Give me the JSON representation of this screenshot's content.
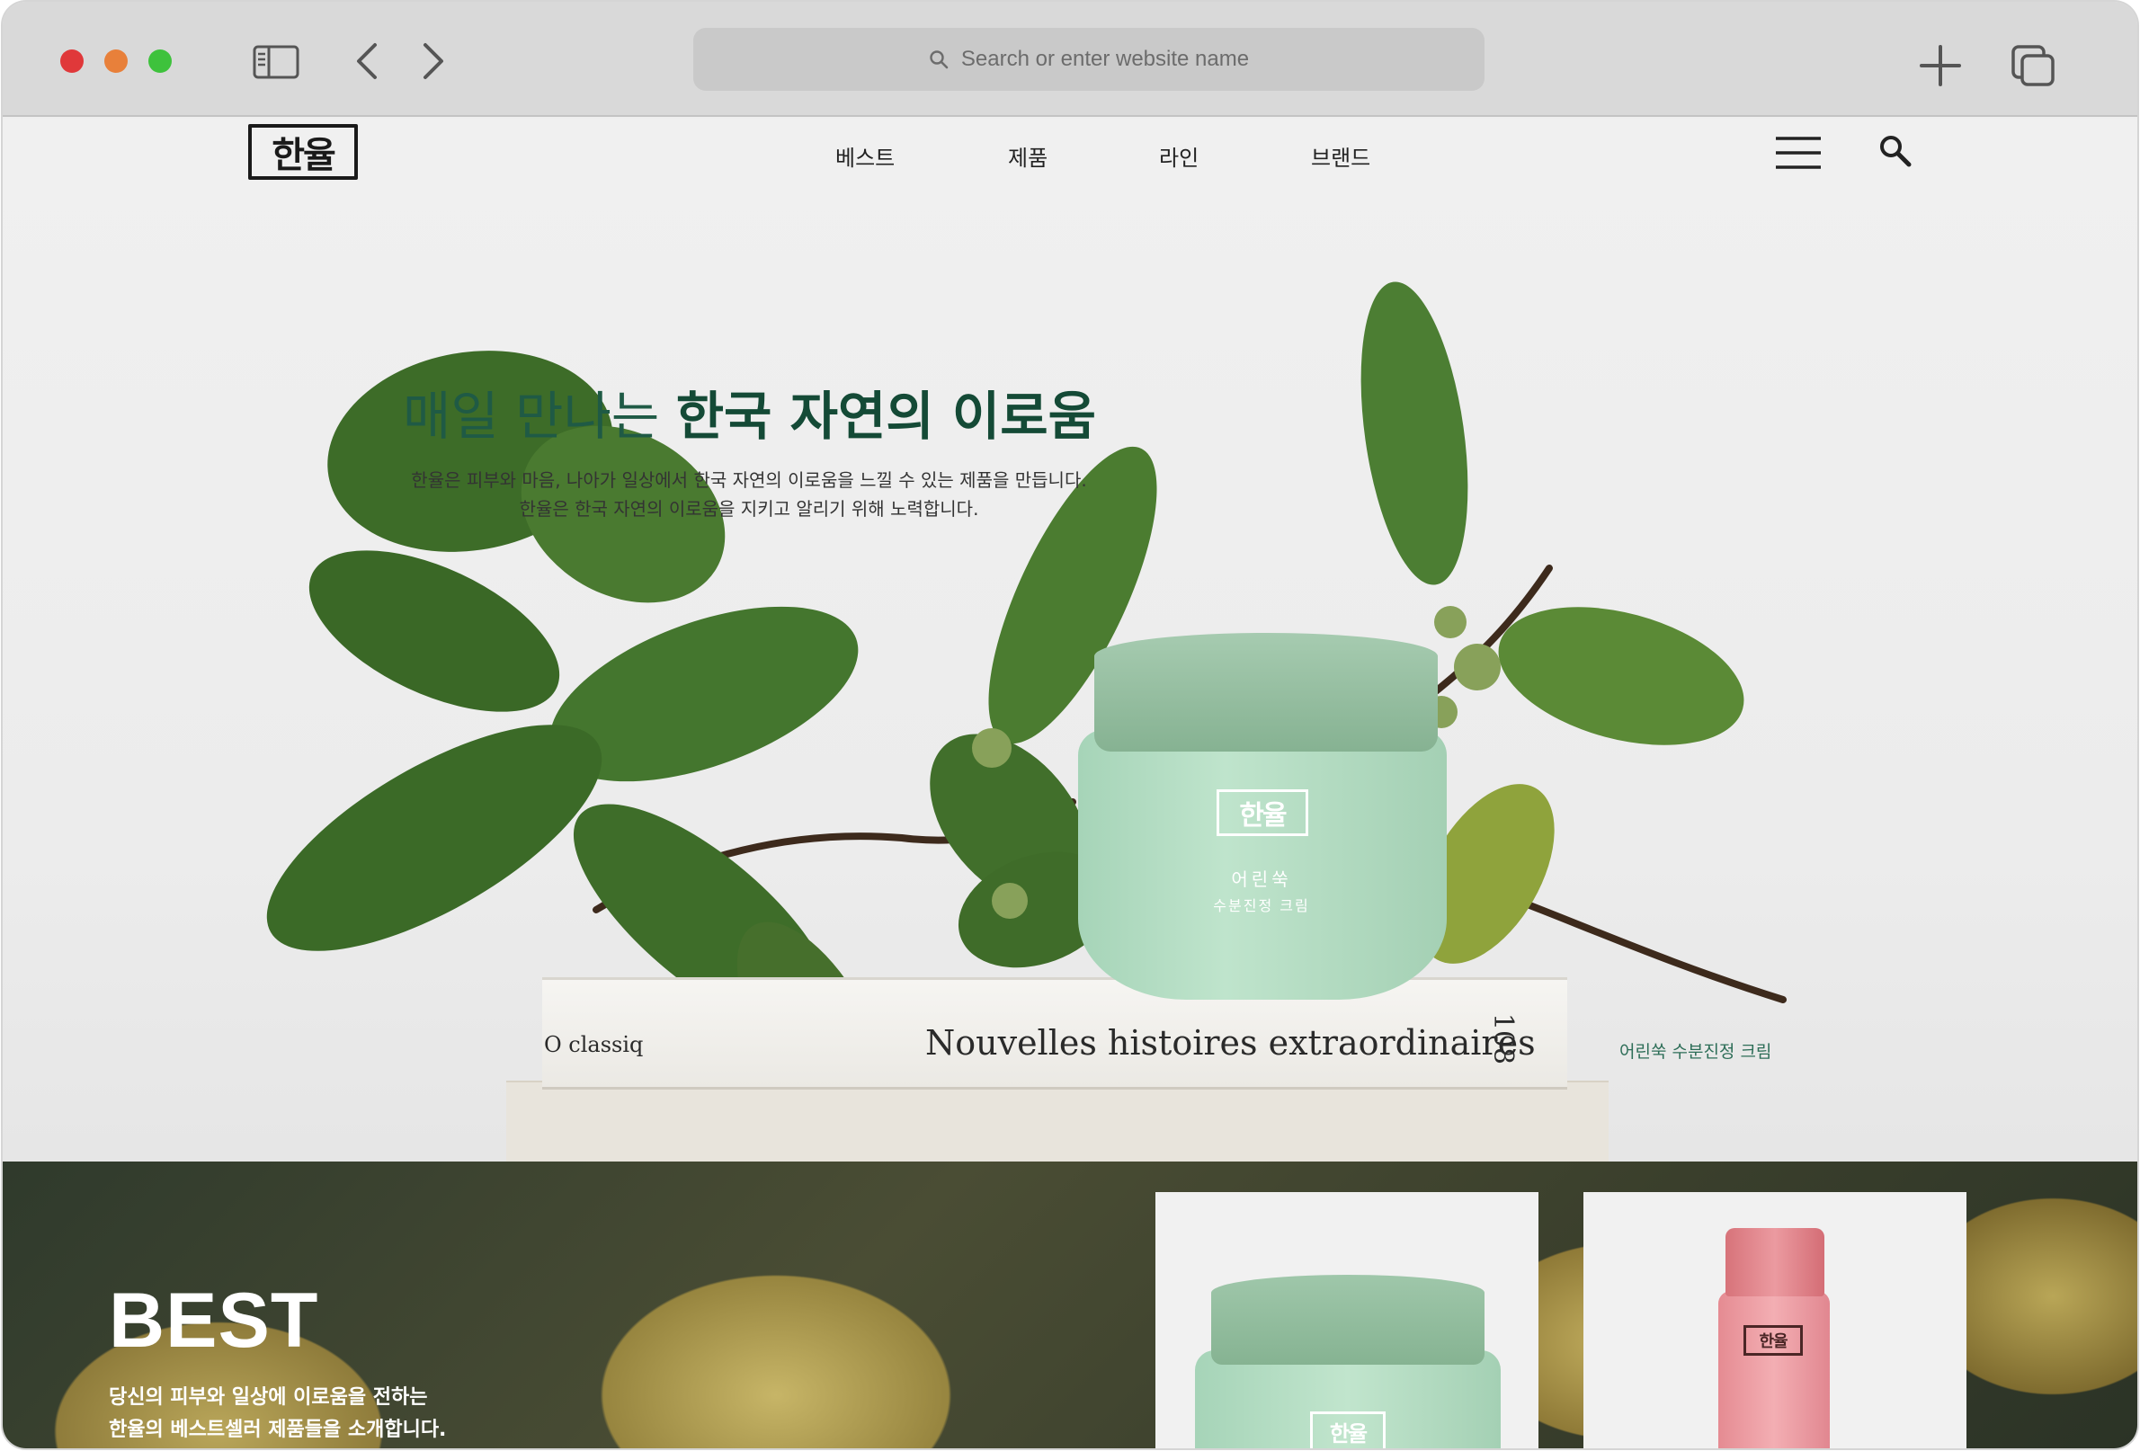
{
  "browser": {
    "address_placeholder": "Search or enter website name"
  },
  "site": {
    "logo_text": "한율",
    "nav": [
      "베스트",
      "제품",
      "라인",
      "브랜드"
    ]
  },
  "hero": {
    "headline_light": "매일 만나는 ",
    "headline_bold": "한국 자연의 이로움",
    "subcopy_1": "한율은 피부와 마음, 나아가 일상에서 한국 자연의 이로움을 느낄 수 있는 제품을 만듭니다.",
    "subcopy_2": "한율은 한국 자연의 이로움을 지키고 알리기 위해 노력합니다.",
    "product_caption": "어린쑥 수분진정 크림",
    "jar_name": "어린쑥",
    "jar_sub": "수분진정 크림",
    "book_title": "Nouvelles histoires extraordinaires",
    "book_number": "108",
    "book_classic": "O classiq"
  },
  "best": {
    "title": "BEST",
    "line_1": "당신의 피부와 일상에 이로움을 전하는",
    "line_2": "한율의 베스트셀러 제품들을 소개합니다."
  },
  "colors": {
    "brand_green": "#144a36",
    "jar_green": "#a6d4b8",
    "bottle_pink": "#eb9aa0"
  }
}
